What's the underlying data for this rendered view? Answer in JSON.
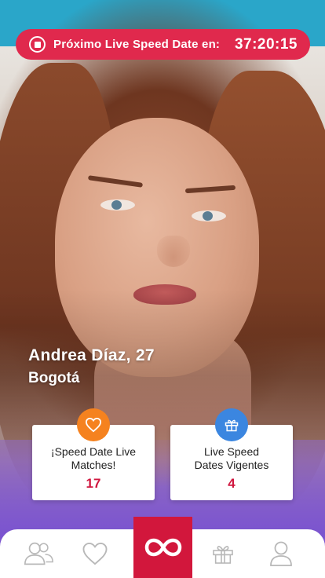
{
  "timer": {
    "label": "Próximo Live Speed Date en:",
    "value": "37:20:15",
    "color": "#e0294d"
  },
  "profile": {
    "name_age": "Andrea Díaz, 27",
    "city": "Bogotá"
  },
  "stats": [
    {
      "icon": "heart-icon",
      "badge_color": "#f5821f",
      "label_line1": "¡Speed Date Live",
      "label_line2": "Matches!",
      "value": "17"
    },
    {
      "icon": "gift-icon",
      "badge_color": "#3b86e0",
      "label_line1": "Live Speed",
      "label_line2": "Dates Vigentes",
      "value": "4"
    }
  ],
  "nav": {
    "items": [
      "users-icon",
      "heart-icon",
      "infinity-icon",
      "gift-icon",
      "profile-icon"
    ],
    "active": "infinity-icon",
    "accent": "#d2173c"
  }
}
